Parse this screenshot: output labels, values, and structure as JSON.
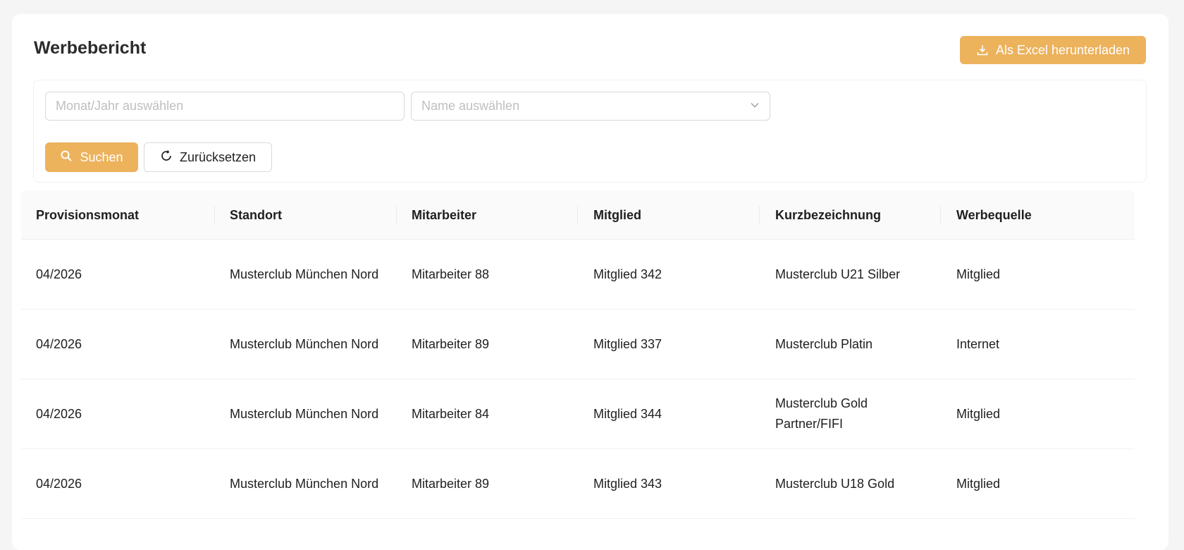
{
  "header": {
    "title": "Werbebericht",
    "export_label": "Als Excel herunterladen",
    "export_icon": "download-icon"
  },
  "filters": {
    "month_placeholder": "Monat/Jahr auswählen",
    "name_placeholder": "Name auswählen",
    "search_label": "Suchen",
    "reset_label": "Zurücksetzen"
  },
  "table": {
    "columns": [
      "Provisionsmonat",
      "Standort",
      "Mitarbeiter",
      "Mitglied",
      "Kurzbezeichnung",
      "Werbequelle"
    ],
    "rows": [
      [
        "04/2026",
        "Musterclub München Nord",
        "Mitarbeiter 88",
        "Mitglied 342",
        "Musterclub U21 Silber",
        "Mitglied"
      ],
      [
        "04/2026",
        "Musterclub München Nord",
        "Mitarbeiter 89",
        "Mitglied 337",
        "Musterclub Platin",
        "Internet"
      ],
      [
        "04/2026",
        "Musterclub München Nord",
        "Mitarbeiter 84",
        "Mitglied 344",
        "Musterclub Gold Partner/FIFI",
        "Mitglied"
      ],
      [
        "04/2026",
        "Musterclub München Nord",
        "Mitarbeiter 89",
        "Mitglied 343",
        "Musterclub U18 Gold",
        "Mitglied"
      ]
    ]
  },
  "colors": {
    "accent": "#ecb25c",
    "background": "#f5f5f5",
    "header_bg": "#fafafa"
  }
}
